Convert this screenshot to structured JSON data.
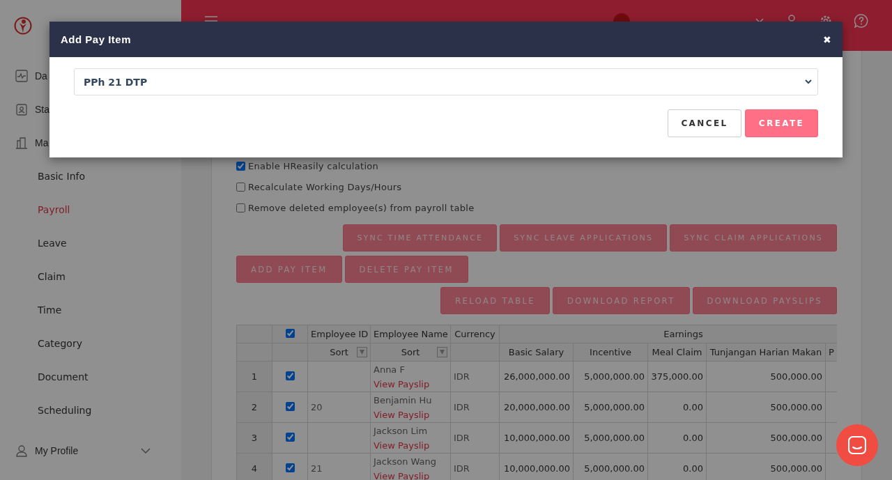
{
  "sidebar": {
    "items": [
      {
        "label": "Da",
        "selected": false
      },
      {
        "label": "Sta",
        "selected": false
      },
      {
        "label": "Ma",
        "selected": false,
        "children": [
          {
            "label": "Basic Info",
            "selected": false
          },
          {
            "label": "Payroll",
            "selected": true
          },
          {
            "label": "Leave",
            "selected": false
          },
          {
            "label": "Claim",
            "selected": false
          },
          {
            "label": "Time",
            "selected": false
          },
          {
            "label": "Category",
            "selected": false
          },
          {
            "label": "Document",
            "selected": false
          },
          {
            "label": "Scheduling",
            "selected": false
          }
        ]
      },
      {
        "label": "My Profile",
        "selected": false
      }
    ]
  },
  "options": [
    {
      "label": "Enable HReasily calculation",
      "checked": true
    },
    {
      "label": "Recalculate Working Days/Hours",
      "checked": false
    },
    {
      "label": "Remove deleted employee(s) from payroll table",
      "checked": false
    }
  ],
  "button_rows": [
    [
      "SYNC TIME ATTENDANCE",
      "SYNC LEAVE APPLICATIONS",
      "SYNC CLAIM APPLICATIONS"
    ],
    [
      "ADD PAY ITEM",
      "DELETE PAY ITEM"
    ],
    [
      "RELOAD TABLE",
      "DOWNLOAD REPORT",
      "DOWNLOAD PAYSLIPS"
    ]
  ],
  "table": {
    "all_checked": true,
    "columns": [
      "Employee ID",
      "Employee Name",
      "Currency"
    ],
    "group": "Earnings",
    "sort": [
      "Sort",
      "Sort"
    ],
    "earnings": [
      "Basic Salary",
      "Incentive",
      "Meal Claim",
      "Tunjangan Harian Makan",
      "P"
    ],
    "rows": [
      {
        "number": "1",
        "checked": true,
        "id": "",
        "name": "Anna F",
        "link": "View Payslip",
        "currency": "IDR",
        "values": [
          "26,000,000.00",
          "5,000,000.00",
          "375,000.00",
          "500,000.00"
        ]
      },
      {
        "number": "2",
        "checked": true,
        "id": "20",
        "name": "Benjamin Hu",
        "link": "View Payslip",
        "currency": "IDR",
        "values": [
          "20,000,000.00",
          "5,000,000.00",
          "0.00",
          "500,000.00"
        ]
      },
      {
        "number": "3",
        "checked": true,
        "id": "",
        "name": "Jackson Lim",
        "link": "View Payslip",
        "currency": "IDR",
        "values": [
          "10,000,000.00",
          "5,000,000.00",
          "0.00",
          "500,000.00"
        ]
      },
      {
        "number": "4",
        "checked": true,
        "id": "21",
        "name": "Jackson Wang",
        "link": "View Payslip",
        "currency": "IDR",
        "values": [
          "10,000,000.00",
          "5,000,000.00",
          "0.00",
          "500,000.00"
        ]
      }
    ]
  },
  "dialog": {
    "title": "Add Pay Item",
    "close": "✖",
    "select_value": "PPh 21 DTP",
    "buttons": [
      {
        "label": "CANCEL",
        "kind": "secondary"
      },
      {
        "label": "CREATE",
        "kind": "primary"
      }
    ]
  }
}
